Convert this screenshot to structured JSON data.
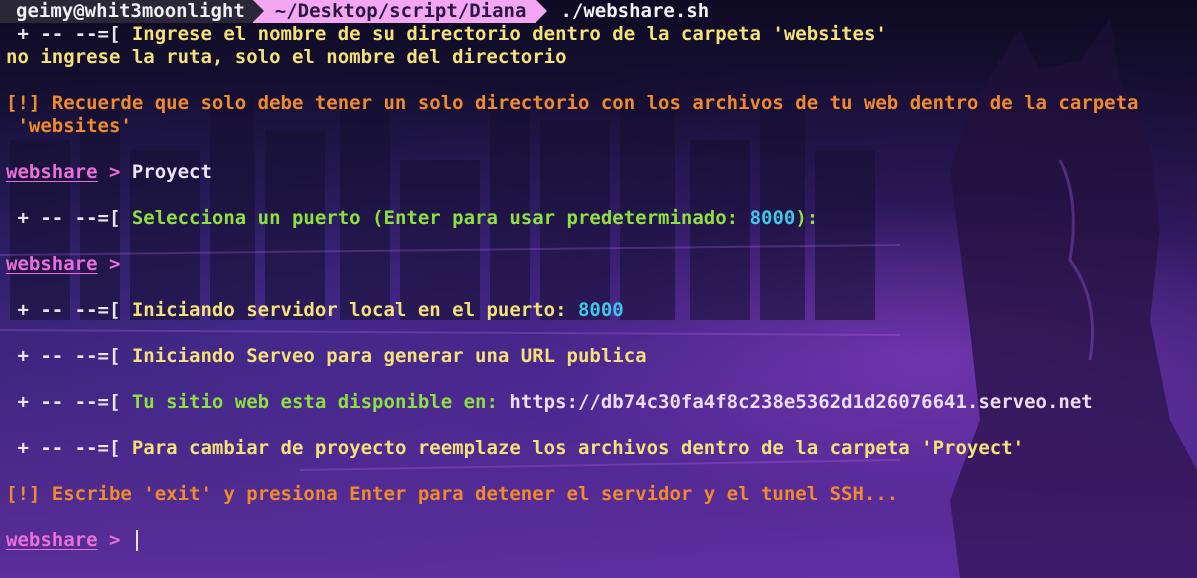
{
  "prompt": {
    "user_host": "geimy@whit3moonlight",
    "path": "~/Desktop/script/Diana",
    "command": "./webshare.sh"
  },
  "colors": {
    "prefix": "#ece6f4",
    "info_text": "#f4e17a",
    "warning_text": "#f08a2c",
    "success_text": "#8ee040",
    "number": "#3ec7e8",
    "shell_prompt": "#ea6fd8",
    "path_segment_bg": "#f3a6f2",
    "user_segment_bg": "#2a2836"
  },
  "output": {
    "prefix": " + -- --=[ ",
    "warn_prefix": "[!] ",
    "shell_prompt": "webshare",
    "shell_arrow": " > ",
    "line1_text": "Ingrese el nombre de su directorio dentro de la carpeta 'websites'",
    "line2_text": "no ingrese la ruta, solo el nombre del directorio",
    "line3_text": "Recuerde que solo debe tener un solo directorio con los archivos de tu web dentro de la carpeta",
    "line4_text": " 'websites'",
    "line5_input": "Proyect",
    "line6_text": "Selecciona un puerto (Enter para usar predeterminado: ",
    "line6_number": "8000",
    "line6_suffix": "):",
    "line8_text": "Iniciando servidor local en el puerto: ",
    "line8_number": "8000",
    "line9_text": "Iniciando Serveo para generar una URL publica",
    "line10_text": "Tu sitio web esta disponible en: ",
    "line10_url": "https://db74c30fa4f8c238e5362d1d26076641.serveo.net",
    "line11_text": "Para cambiar de proyecto reemplaze los archivos dentro de la carpeta 'Proyect'",
    "line12_text": "Escribe 'exit' y presiona Enter para detener el servidor y el tunel SSH..."
  }
}
